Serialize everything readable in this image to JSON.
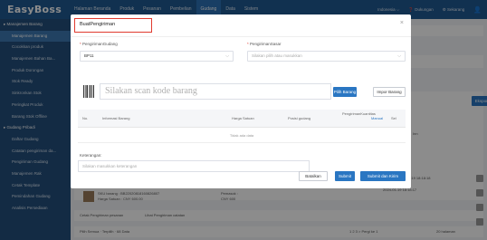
{
  "app": {
    "logo": "EasyBoss"
  },
  "nav": [
    "Halaman Beranda",
    "Produk",
    "Pesanan",
    "Pembelian",
    "Gudang",
    "Data",
    "Sistem"
  ],
  "nav_active": 4,
  "topright": {
    "lang": "Indonesia ⌵",
    "help": "❓ Dukungan",
    "user": "⚙ Sekarang"
  },
  "sidebar": [
    {
      "label": "Manajemen Barang",
      "type": "group"
    },
    {
      "label": "Manajemen Barang",
      "type": "item",
      "active": true
    },
    {
      "label": "Cocokkan produk",
      "type": "item"
    },
    {
      "label": "Manajemen Bahan Ba...",
      "type": "item"
    },
    {
      "label": "Produk Dorongan",
      "type": "item"
    },
    {
      "label": "Stok Ready",
      "type": "item"
    },
    {
      "label": "Sinkronkan Stok",
      "type": "item"
    },
    {
      "label": "Peringkat Produk",
      "type": "item"
    },
    {
      "label": "Barang Stok Offline",
      "type": "item"
    },
    {
      "label": "Gudang Pribadi",
      "type": "group"
    },
    {
      "label": "Daftar Gudang",
      "type": "item"
    },
    {
      "label": "Catatan pengiriman da...",
      "type": "item"
    },
    {
      "label": "Pengiriman Gudang",
      "type": "item"
    },
    {
      "label": "Manajemen Rak",
      "type": "item"
    },
    {
      "label": "Cetak Template",
      "type": "item"
    },
    {
      "label": "Pemindahan Gudang",
      "type": "item"
    },
    {
      "label": "Analisis Persediaan",
      "type": "item"
    }
  ],
  "modal": {
    "title": "BuatPengiriman",
    "close": "×",
    "warehouse_label": "PengirimanGudang",
    "warehouse_value": "BP11",
    "supplier_label": "PengirimanSasar",
    "supplier_placeholder": "Silakan pilih atau masukkan",
    "scan_placeholder": "Silakan scan kode barang",
    "pick_button": "Pilih Barang",
    "import_button": "Impor Barang",
    "columns": {
      "no": "No.",
      "info": "Informasi Barang",
      "price": "Harga Satuan",
      "position": "Posisi gudang",
      "qty": "PengirimanKuantitas",
      "manual": "Manual",
      "sel": "Sel"
    },
    "empty": "Tidak ada data",
    "notes_label": "Keterangan:",
    "notes_placeholder": "Silakan masukkan keterangan",
    "cancel": "Batalkan",
    "submit": "Submit",
    "submit_review": "Submit dan Kirim"
  },
  "background": {
    "export": "Ekspor ⌵",
    "col_right": "Inn",
    "row_sku": "SKU barang : BB22020818160826807",
    "row_price": "Harga Satuan : CNY 600.00",
    "row_supplier": "Pemasok :",
    "row_cost": "CNY 600",
    "time1": "Terima : 2024-01-19 18:18:18",
    "time2": "2024-01-19 18:18:17",
    "footer_left": "Cetak Pengiriman pesanan",
    "footer_link": "Lihat Pengiriman catatan",
    "pager_info": "Pilih Semua  ·  Terpilih  ·  68 Data",
    "pager_pages": "1  2  3  >  Pergi ke  1",
    "pager_size": "20 halaman"
  }
}
